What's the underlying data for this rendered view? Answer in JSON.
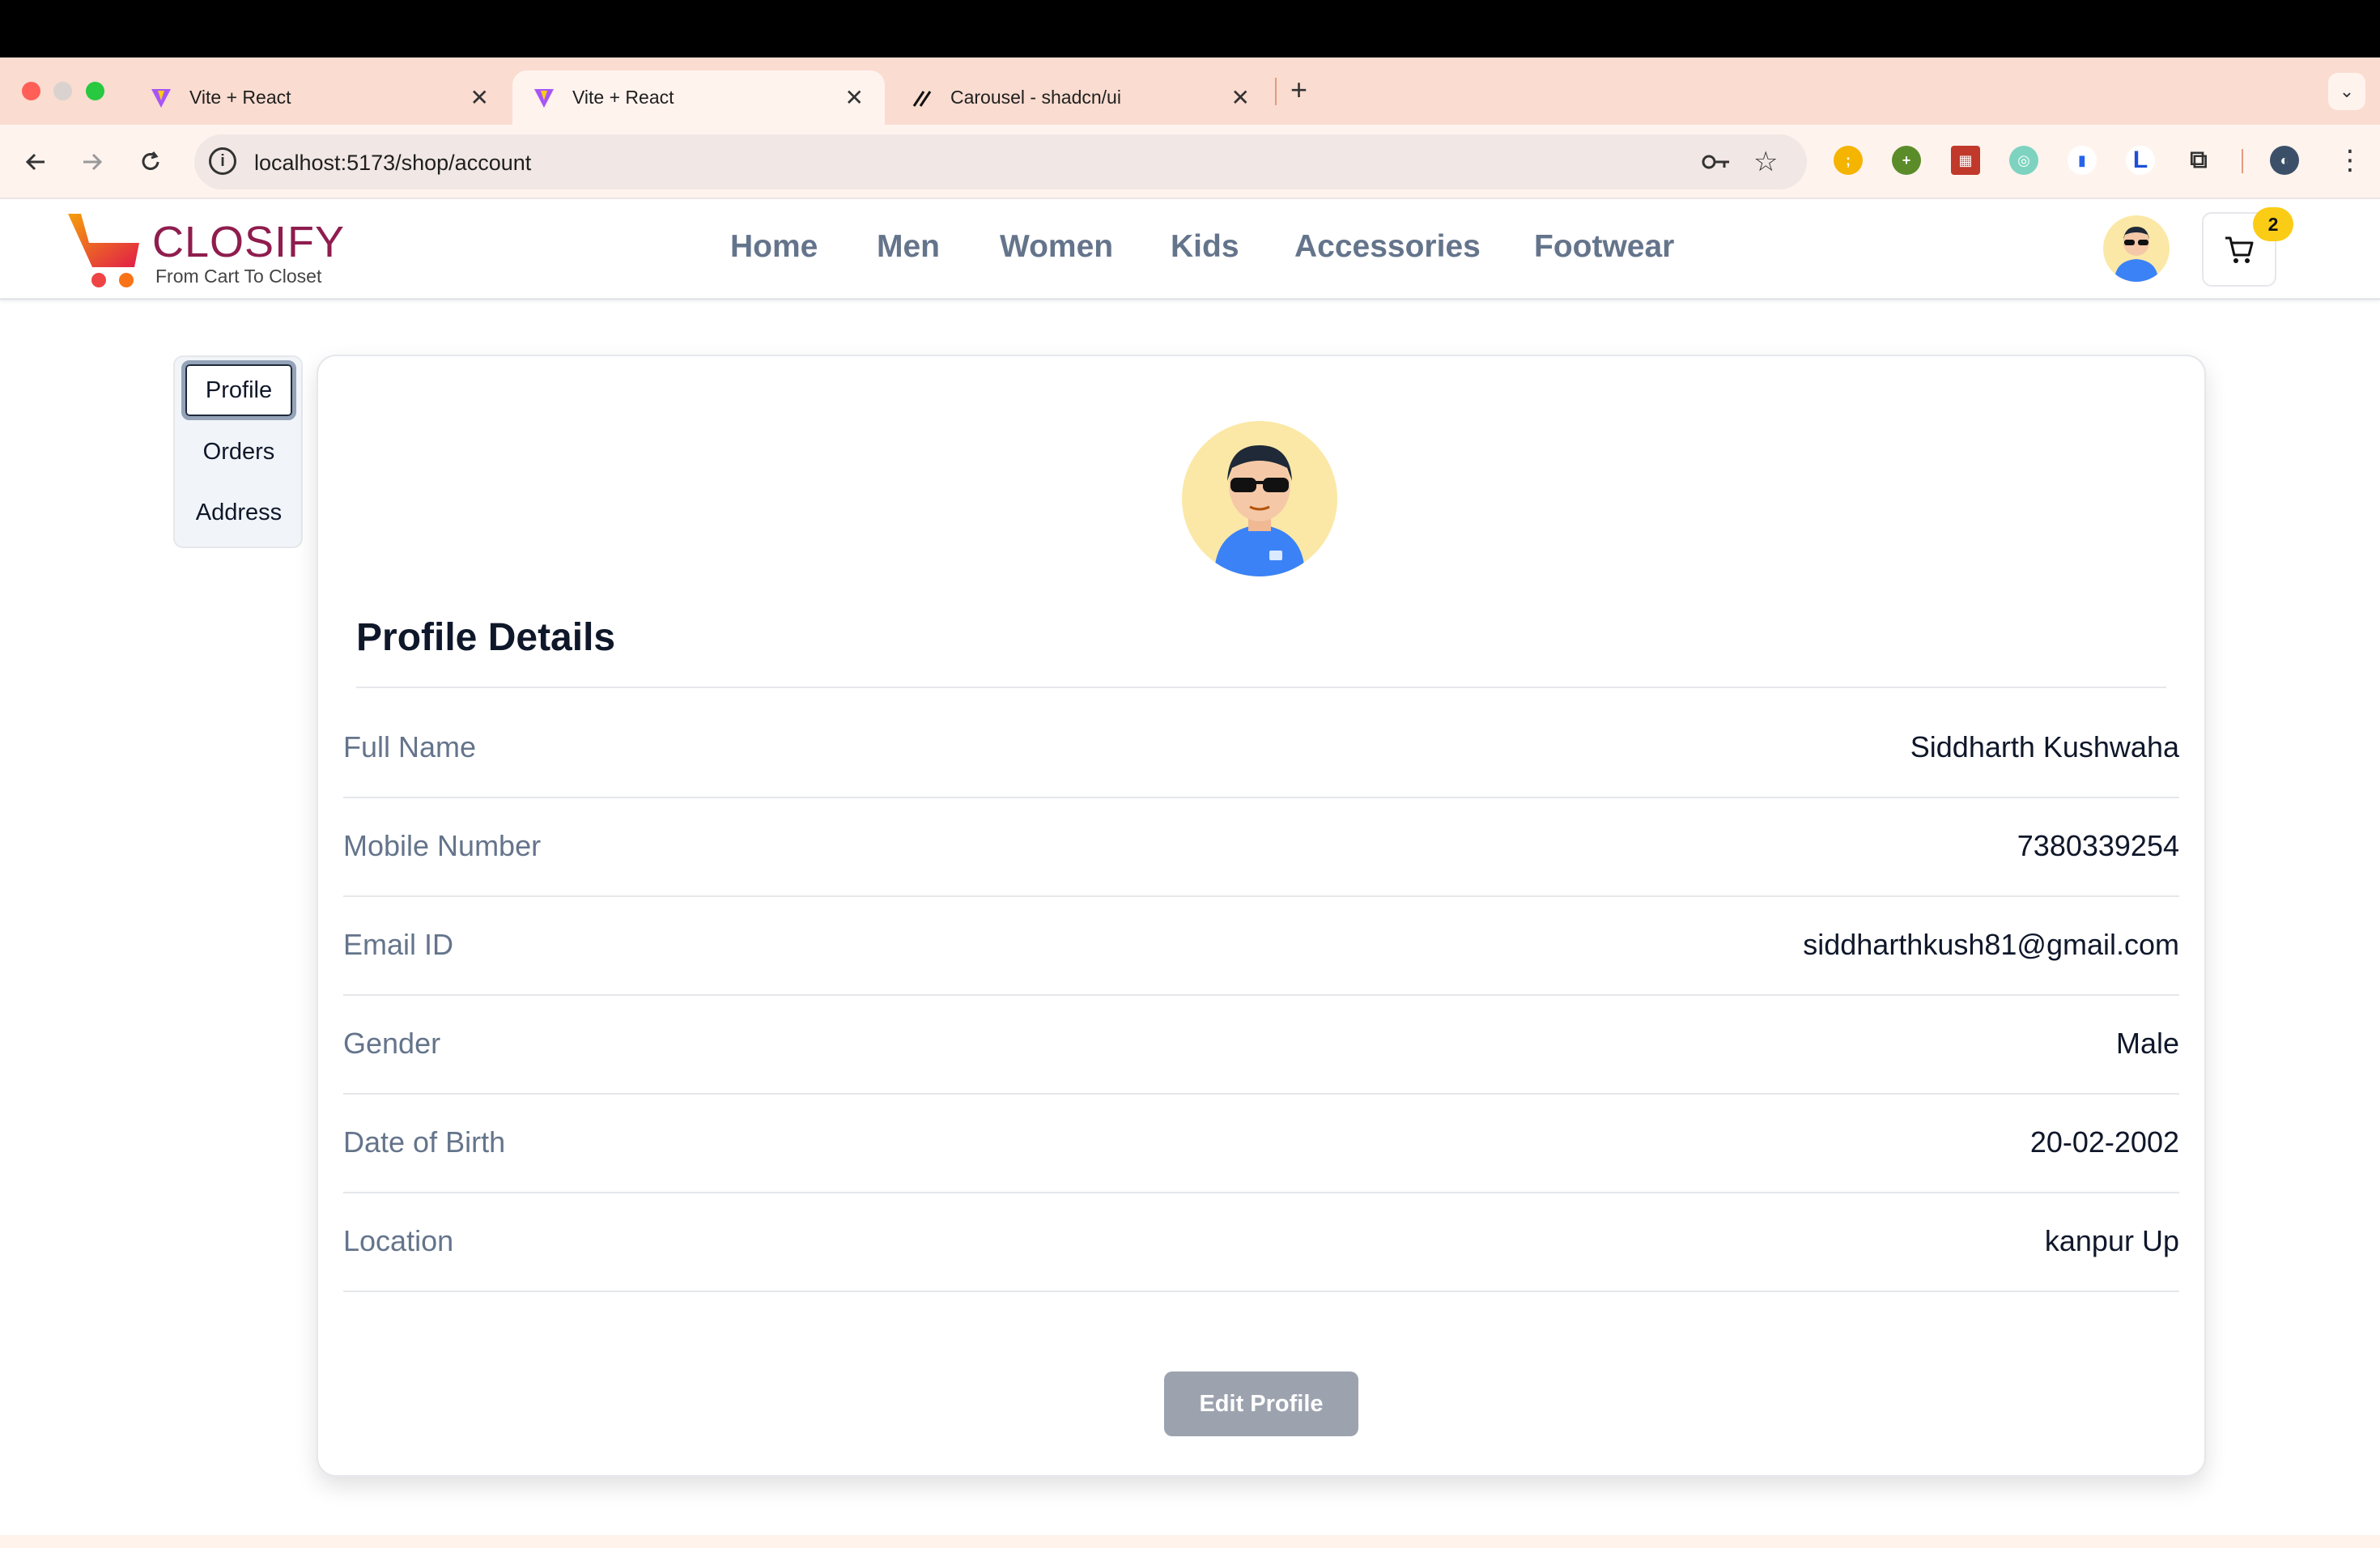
{
  "browser": {
    "tabs": [
      {
        "title": "Vite + React",
        "active": false
      },
      {
        "title": "Vite + React",
        "active": true
      },
      {
        "title": "Carousel - shadcn/ui",
        "active": false
      }
    ],
    "new_tab_label": "+",
    "url": "localhost:5173/shop/account"
  },
  "site": {
    "brand": "CLOSIFY",
    "tagline": "From Cart To Closet",
    "nav": [
      "Home",
      "Men",
      "Women",
      "Kids",
      "Accessories",
      "Footwear"
    ],
    "cart_count": "2"
  },
  "account": {
    "side_tabs": [
      "Profile",
      "Orders",
      "Address"
    ],
    "active_tab": "Profile",
    "section_title": "Profile Details",
    "fields": [
      {
        "label": "Full Name",
        "value": "Siddharth Kushwaha"
      },
      {
        "label": "Mobile Number",
        "value": "7380339254"
      },
      {
        "label": "Email ID",
        "value": "siddharthkush81@gmail.com"
      },
      {
        "label": "Gender",
        "value": "Male"
      },
      {
        "label": "Date of Birth",
        "value": "20-02-2002"
      },
      {
        "label": "Location",
        "value": "kanpur Up"
      }
    ],
    "edit_button": "Edit Profile"
  },
  "colors": {
    "brand": "#8f1d4e",
    "tabstrip": "#fadcd0",
    "badge": "#facc15",
    "nav_text": "#64748b",
    "edit_button": "#9ca3af"
  }
}
